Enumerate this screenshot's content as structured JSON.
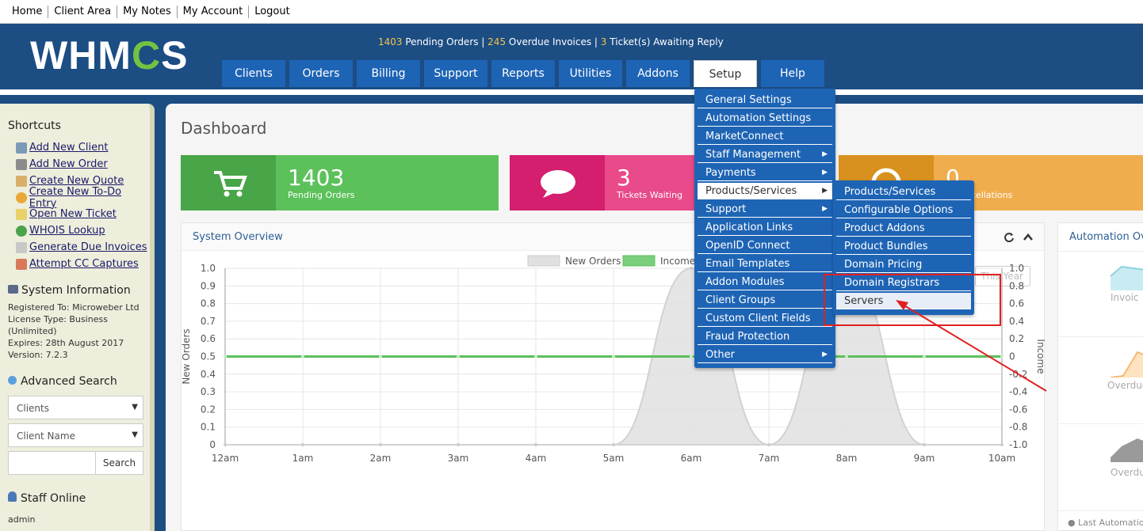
{
  "topbar": {
    "links": [
      "Home",
      "Client Area",
      "My Notes",
      "My Account",
      "Logout"
    ]
  },
  "header": {
    "logo_text": "WHMCS",
    "stats": {
      "pending_orders_count": "1403",
      "pending_orders_label": " Pending Orders | ",
      "overdue_count": "245",
      "overdue_label": " Overdue Invoices | ",
      "tickets_count": "3",
      "tickets_label": " Ticket(s) Awaiting Reply"
    },
    "nav": [
      "Clients",
      "Orders",
      "Billing",
      "Support",
      "Reports",
      "Utilities",
      "Addons",
      "Setup",
      "Help"
    ]
  },
  "sidebar": {
    "shortcuts_title": "Shortcuts",
    "shortcuts": [
      "Add New Client",
      "Add New Order",
      "Create New Quote",
      "Create New To-Do Entry",
      "Open New Ticket",
      "WHOIS Lookup",
      "Generate Due Invoices",
      "Attempt CC Captures"
    ],
    "system_info_title": "System Information",
    "system_info": [
      "Registered To: Microweber Ltd",
      "License Type: Business",
      "(Unlimited)",
      "Expires: 28th August 2017",
      "Version: 7.2.3"
    ],
    "advanced_search_title": "Advanced Search",
    "search_type": "Clients",
    "search_field": "Client Name",
    "search_button": "Search",
    "staff_online_title": "Staff Online",
    "staff_online": "admin"
  },
  "main": {
    "title": "Dashboard",
    "tiles": [
      {
        "value": "1403",
        "label": "Pending Orders",
        "color": "#5cc15a"
      },
      {
        "value": "3",
        "label": "Tickets Waiting",
        "color": "#e84a8a"
      },
      {
        "value": "0",
        "label": "g Cancellations",
        "color": "#f0ad4e"
      }
    ],
    "system_overview_title": "System Overview",
    "automation_title": "Automation Ov",
    "range_button": "This Year",
    "automation_labels": [
      "Invoic",
      "Overdue",
      "Overdu"
    ],
    "last_automation": "Last Automatio"
  },
  "setup_menu": [
    {
      "label": "General Settings"
    },
    {
      "label": "Automation Settings"
    },
    {
      "label": "MarketConnect"
    },
    {
      "label": "Staff Management",
      "submenu": true
    },
    {
      "label": "Payments",
      "submenu": true
    },
    {
      "label": "Products/Services",
      "submenu": true,
      "hover": true
    },
    {
      "label": "Support",
      "submenu": true
    },
    {
      "label": "Application Links"
    },
    {
      "label": "OpenID Connect"
    },
    {
      "label": "Email Templates"
    },
    {
      "label": "Addon Modules"
    },
    {
      "label": "Client Groups"
    },
    {
      "label": "Custom Client Fields"
    },
    {
      "label": "Fraud Protection"
    },
    {
      "label": "Other",
      "submenu": true
    }
  ],
  "products_submenu": [
    "Products/Services",
    "Configurable Options",
    "Product Addons",
    "Product Bundles",
    "Domain Pricing",
    "Domain Registrars",
    "Servers"
  ],
  "chart_data": {
    "type": "area",
    "title": "",
    "x": [
      "12am",
      "1am",
      "2am",
      "3am",
      "4am",
      "5am",
      "6am",
      "7am",
      "8am",
      "9am",
      "10am"
    ],
    "series": [
      {
        "name": "New Orders",
        "color": "#e0e0e0",
        "values": [
          0,
          0,
          0,
          0,
          0,
          0,
          1,
          0,
          1,
          0,
          0
        ]
      },
      {
        "name": "Income",
        "color": "#7bcf7b",
        "values": [
          0,
          0,
          0,
          0,
          0,
          0,
          0,
          0,
          0,
          0,
          0
        ]
      }
    ],
    "ylabel": "New Orders",
    "y2label": "Income",
    "ylim": [
      0,
      1.0
    ],
    "y2lim": [
      -1.0,
      1.0
    ],
    "yticks": [
      "1.0",
      "0.9",
      "0.8",
      "0.7",
      "0.6",
      "0.5",
      "0.4",
      "0.3",
      "0.2",
      "0.1",
      "0"
    ],
    "y2ticks": [
      "1.0",
      "0.8",
      "0.6",
      "0.4",
      "0.2",
      "0",
      "-0.2",
      "-0.4",
      "-0.6",
      "-0.8",
      "-1.0"
    ],
    "legend": "top-center",
    "grid": true
  }
}
